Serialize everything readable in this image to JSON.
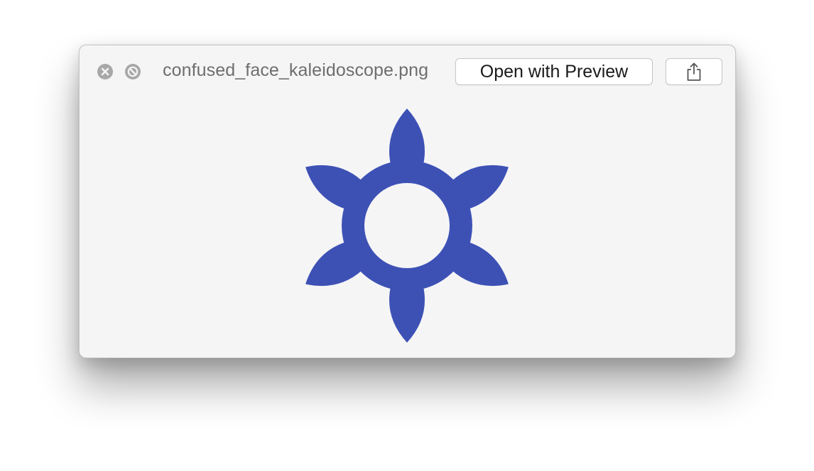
{
  "window": {
    "filename": "confused_face_kaleidoscope.png",
    "open_button_label": "Open with Preview",
    "share_button_icon": "share-icon",
    "close_button_icon": "close-icon",
    "fullscreen_button_icon": "fullscreen-icon"
  },
  "preview": {
    "image_icon": "flower-icon",
    "flower_color": "#3d51b5",
    "background_color": "#f5f5f6"
  }
}
